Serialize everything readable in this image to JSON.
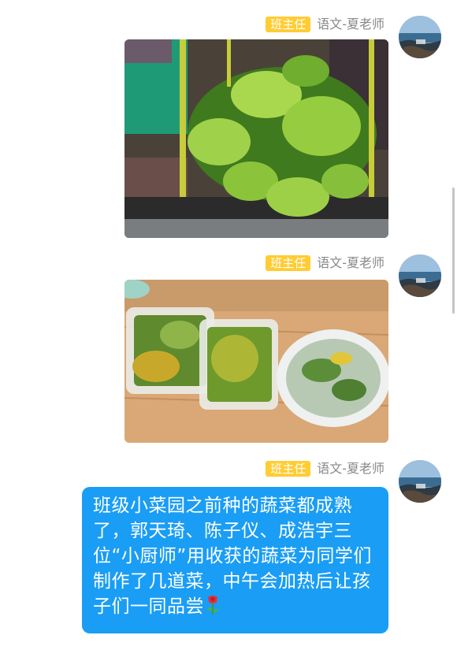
{
  "messages": [
    {
      "role_badge": "班主任",
      "sender_name": "语文-夏老师",
      "type": "image",
      "image_icon": "vegetable-garden-photo"
    },
    {
      "role_badge": "班主任",
      "sender_name": "语文-夏老师",
      "type": "image",
      "image_icon": "cooked-dishes-photo"
    },
    {
      "role_badge": "班主任",
      "sender_name": "语文-夏老师",
      "type": "text",
      "text": "班级小菜园之前种的蔬菜都成熟了，郭天琦、陈子仪、成浩宇三位“小厨师”用收获的蔬菜为同学们制作了几道菜，中午会加热后让孩子们一同品尝",
      "emoji_icon": "rose-icon"
    }
  ],
  "colors": {
    "badge_bg": "#ffcc33",
    "bubble_bg": "#1a9df5",
    "sender_text": "#888888"
  }
}
